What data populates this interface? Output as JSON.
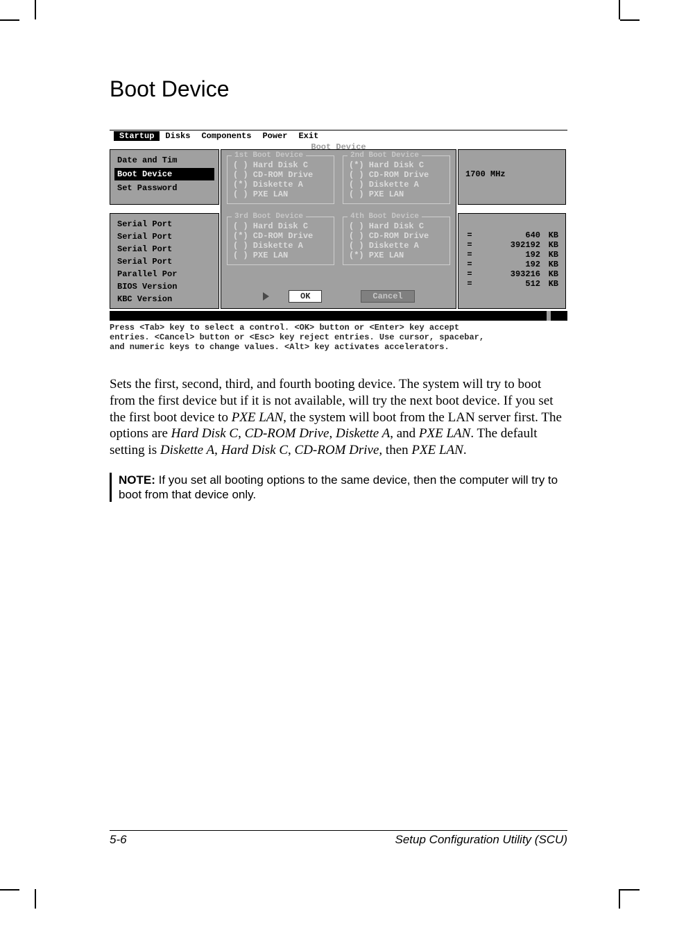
{
  "page": {
    "title": "Boot Device",
    "footer_left": "5-6",
    "footer_right": "Setup Configuration Utility (SCU)"
  },
  "bios": {
    "menu": [
      "Startup",
      "Disks",
      "Components",
      "Power",
      "Exit"
    ],
    "menu_active_index": 0,
    "dialog_title": "Boot Device",
    "left_panel_1": [
      "Date and Tim",
      "Boot Device",
      "Set Password"
    ],
    "left_panel_1_selected_index": 1,
    "left_panel_2": [
      "Serial Port",
      "Serial Port",
      "Serial Port",
      "Serial Port",
      "Parallel Por",
      "BIOS Version",
      "KBC  Version"
    ],
    "right_panel_1": "1700 MHz",
    "right_panel_2": [
      {
        "eq": "=",
        "val": "640",
        "unit": "KB"
      },
      {
        "eq": "=",
        "val": "392192",
        "unit": "KB"
      },
      {
        "eq": "=",
        "val": "192",
        "unit": "KB"
      },
      {
        "eq": "=",
        "val": "192",
        "unit": "KB"
      },
      {
        "eq": "=",
        "val": "393216",
        "unit": "KB"
      },
      {
        "eq": "=",
        "val": "512",
        "unit": "KB"
      }
    ],
    "groups": [
      {
        "title": "1st Boot Device",
        "options": [
          "Hard Disk C",
          "CD-ROM Drive",
          "Diskette A",
          "PXE LAN"
        ],
        "selected": 2
      },
      {
        "title": "2nd Boot Device",
        "options": [
          "Hard Disk C",
          "CD-ROM Drive",
          "Diskette A",
          "PXE LAN"
        ],
        "selected": 0
      },
      {
        "title": "3rd Boot Device",
        "options": [
          "Hard Disk C",
          "CD-ROM Drive",
          "Diskette A",
          "PXE LAN"
        ],
        "selected": 1
      },
      {
        "title": "4th Boot Device",
        "options": [
          "Hard Disk C",
          "CD-ROM Drive",
          "Diskette A",
          "PXE LAN"
        ],
        "selected": 3
      }
    ],
    "ok_label": "OK",
    "cancel_label": "Cancel",
    "help": [
      "Press <Tab> key to select a control. <OK> button or <Enter> key accept",
      "entries. <Cancel> button or <Esc> key reject entries. Use cursor, spacebar,",
      "and numeric keys to change values. <Alt> key activates accelerators."
    ]
  },
  "body": {
    "p1a": "Sets the first, second, third, and fourth booting device. The system will try to boot from the first device but if it is not available, will try the next boot device. If you set the first boot device to ",
    "p1b": "PXE LAN",
    "p1c": ", the system will boot from the LAN server first. The options are ",
    "opt1": "Hard Disk C",
    "sep1": ", ",
    "opt2": "CD-ROM Drive",
    "sep2": ", ",
    "opt3": "Diskette A",
    "sep3": ", and ",
    "opt4": "PXE LAN",
    "p1d": ". The default setting is ",
    "def1": "Diskette A",
    "def_sep1": ", ",
    "def2": "Hard Disk C",
    "def_sep2": ", ",
    "def3": "CD-ROM Drive,",
    "def_sep3": " then ",
    "def4": "PXE LAN",
    "p1e": ".",
    "note_label": "NOTE:",
    "note_text": " If you set all booting options to the same device, then the computer will try to boot from that device only."
  }
}
